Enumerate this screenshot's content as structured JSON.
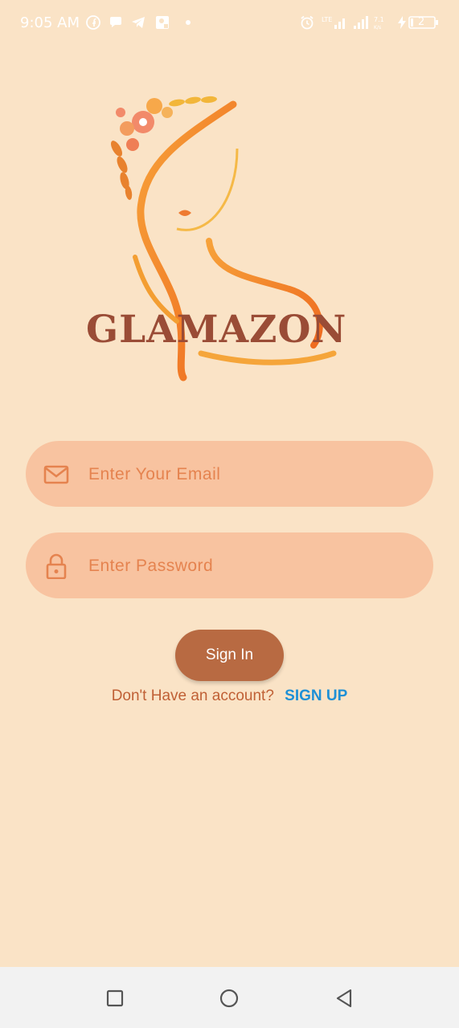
{
  "status_bar": {
    "time": "9:05 AM",
    "battery": "2"
  },
  "logo": {
    "brand": "GLAMAZON"
  },
  "login_form": {
    "email_placeholder": "Enter Your Email",
    "password_placeholder": "Enter Password",
    "sign_in_label": "Sign In",
    "signup_prompt": "Don't Have an account?",
    "signup_link": "SIGN UP"
  },
  "colors": {
    "background": "#FAE3C6",
    "field_bg": "#F8C3A0",
    "accent_orange": "#E5834F",
    "button": "#B86A42",
    "link": "#1E90D6",
    "brand_text": "#9A4C36"
  },
  "icons": {
    "email": "envelope-icon",
    "password": "lock-icon",
    "nav": [
      "recents-icon",
      "home-icon",
      "back-icon"
    ]
  }
}
